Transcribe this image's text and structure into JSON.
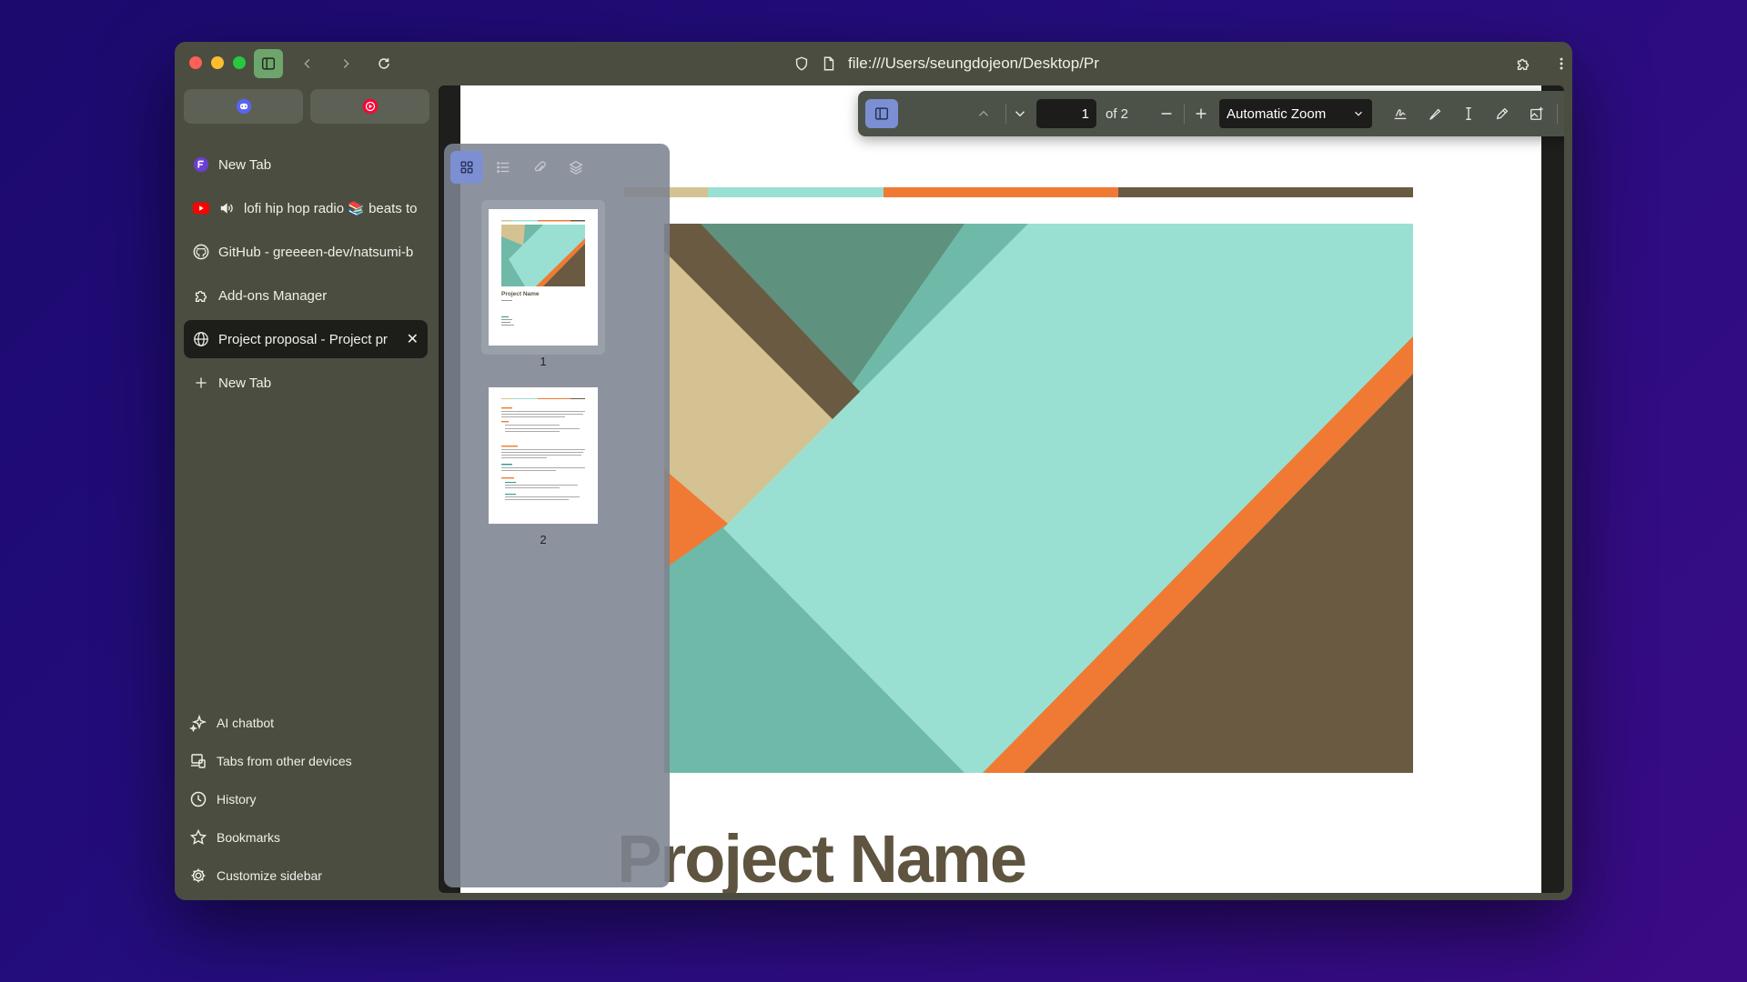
{
  "browser": {
    "url": "file:///Users/seungdojeon/Desktop/Pr"
  },
  "sidebar": {
    "pinned": [
      {
        "name": "discord-pin",
        "color": "#5865f2"
      },
      {
        "name": "youtube-music-pin",
        "color": "#ff0033"
      }
    ],
    "tabs": [
      {
        "label": "New Tab",
        "icon": "zen-logo-icon"
      },
      {
        "label": "lofi hip hop radio 📚 beats to",
        "icon": "youtube-icon",
        "audio": true
      },
      {
        "label": "GitHub - greeeen-dev/natsumi-b",
        "icon": "github-icon"
      },
      {
        "label": "Add-ons Manager",
        "icon": "puzzle-icon"
      },
      {
        "label": "Project proposal - Project pr",
        "icon": "globe-icon",
        "active": true
      },
      {
        "label": "New Tab",
        "icon": "plus-icon"
      }
    ],
    "bottom": [
      {
        "label": "AI chatbot",
        "icon": "sparkle-icon"
      },
      {
        "label": "Tabs from other devices",
        "icon": "devices-icon"
      },
      {
        "label": "History",
        "icon": "clock-icon"
      },
      {
        "label": "Bookmarks",
        "icon": "star-icon"
      },
      {
        "label": "Customize sidebar",
        "icon": "gear-icon"
      }
    ]
  },
  "pdf": {
    "page_value": "1",
    "of_label": "of 2",
    "zoom": "Automatic Zoom",
    "thumbnails": [
      {
        "num": "1",
        "title": "Project Name"
      },
      {
        "num": "2"
      }
    ],
    "document_title": "Project Name",
    "colors": {
      "tan": "#d4c293",
      "mint": "#9ae0d2",
      "orange": "#f07a33",
      "brown": "#6b5a42"
    }
  }
}
